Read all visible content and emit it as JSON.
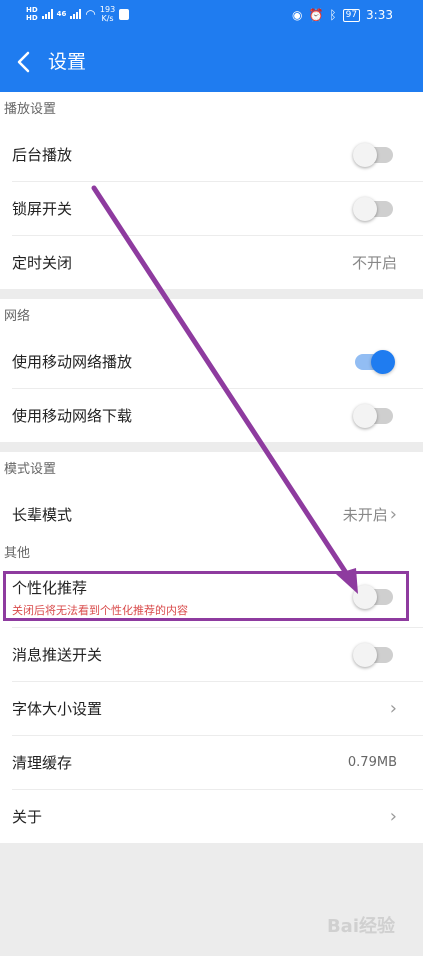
{
  "status_bar": {
    "sim1": "HD",
    "sim2": "HD",
    "signal_label": "46",
    "net_speed_value": "193",
    "net_speed_unit": "K/s",
    "battery": "97",
    "time": "3:33"
  },
  "header": {
    "title": "设置"
  },
  "sections": {
    "playback": {
      "title": "播放设置",
      "items": [
        {
          "label": "后台播放",
          "toggle": false
        },
        {
          "label": "锁屏开关",
          "toggle": false
        },
        {
          "label": "定时关闭",
          "value": "不开启"
        }
      ]
    },
    "network": {
      "title": "网络",
      "items": [
        {
          "label": "使用移动网络播放",
          "toggle": true
        },
        {
          "label": "使用移动网络下载",
          "toggle": false
        }
      ]
    },
    "mode": {
      "title": "模式设置",
      "items": [
        {
          "label": "长辈模式",
          "value": "未开启"
        }
      ]
    },
    "other": {
      "title": "其他",
      "items": [
        {
          "label": "个性化推荐",
          "sub": "关闭后将无法看到个性化推荐的内容",
          "toggle": false
        },
        {
          "label": "消息推送开关",
          "toggle": false
        },
        {
          "label": "字体大小设置"
        },
        {
          "label": "清理缓存",
          "value": "0.79MB"
        },
        {
          "label": "关于"
        }
      ]
    }
  },
  "watermark": "Bai经验",
  "colors": {
    "accent": "#1f7cf0",
    "annotation": "#8e3b9f",
    "warning_text": "#d94b4b"
  }
}
